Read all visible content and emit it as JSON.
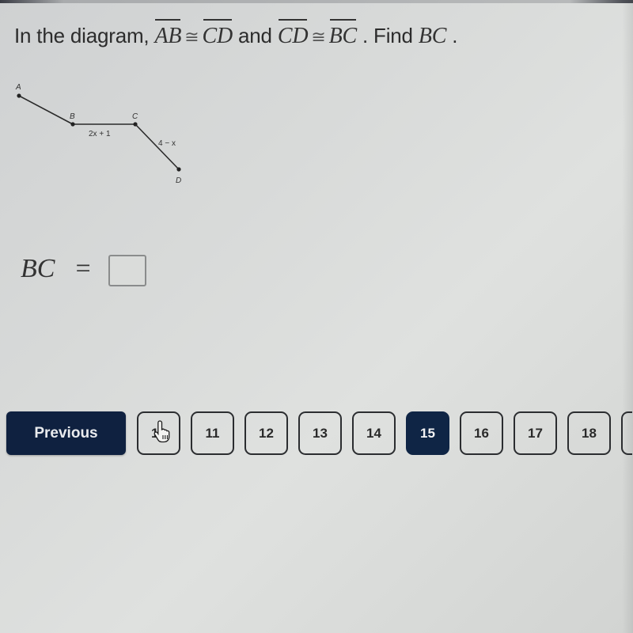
{
  "question": {
    "prefix": "In the diagram, ",
    "seg1": "AB",
    "cong_symbol": "≅",
    "seg2": "CD",
    "and": " and ",
    "seg3": "CD",
    "seg4": "BC",
    "find_text": " . Find ",
    "find_target": "BC",
    "suffix": " ."
  },
  "diagram": {
    "points": [
      "A",
      "B",
      "C",
      "D"
    ],
    "label_bc": "2x + 1",
    "label_cd": "4 − x"
  },
  "answer": {
    "label": "BC",
    "equals": "=",
    "value": "",
    "placeholder": ""
  },
  "navigation": {
    "previous_label": "Previous",
    "pages": [
      "10",
      "11",
      "12",
      "13",
      "14",
      "15",
      "16",
      "17",
      "18"
    ],
    "current_page": "15",
    "cursor_over_page": "10"
  },
  "colors": {
    "nav_dark": "#0f2140",
    "active_page": "#0f2545",
    "background": "#d8dad9"
  }
}
